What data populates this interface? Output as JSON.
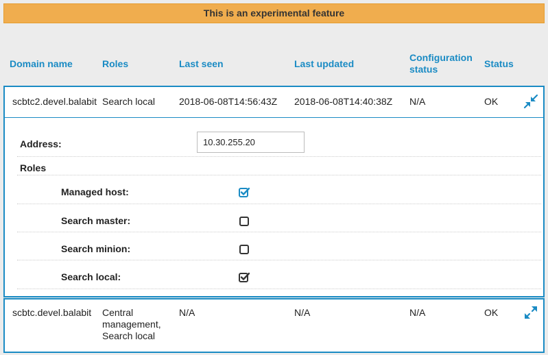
{
  "banner": {
    "text": "This is an experimental feature"
  },
  "table": {
    "headers": {
      "domain_name": "Domain name",
      "roles": "Roles",
      "last_seen": "Last seen",
      "last_updated": "Last updated",
      "config_status_line1": "Configuration",
      "config_status_line2": "status",
      "status": "Status"
    },
    "rows": [
      {
        "domain_name": "scbtc2.devel.balabit",
        "roles": "Search local",
        "last_seen": "2018-06-08T14:56:43Z",
        "last_updated": "2018-06-08T14:40:38Z",
        "config_status": "N/A",
        "status": "OK",
        "toggle_icon": "collapse-icon",
        "expanded": true,
        "details": {
          "address_label": "Address:",
          "address_value": "10.30.255.20",
          "roles_heading": "Roles",
          "role_options": [
            {
              "label": "Managed host:",
              "checked": true,
              "accent": "#1a8bc4"
            },
            {
              "label": "Search master:",
              "checked": false
            },
            {
              "label": "Search minion:",
              "checked": false
            },
            {
              "label": "Search local:",
              "checked": true,
              "accent": "#333333"
            }
          ]
        }
      },
      {
        "domain_name": "scbtc.devel.balabit",
        "roles_line1": "Central",
        "roles_line2": "management,",
        "roles_line3": "Search local",
        "last_seen": "N/A",
        "last_updated": "N/A",
        "config_status": "N/A",
        "status": "OK",
        "toggle_icon": "expand-icon",
        "expanded": false
      }
    ]
  },
  "colors": {
    "accent": "#1a8bc4",
    "banner": "#f0ad4e",
    "background": "#ececec"
  }
}
